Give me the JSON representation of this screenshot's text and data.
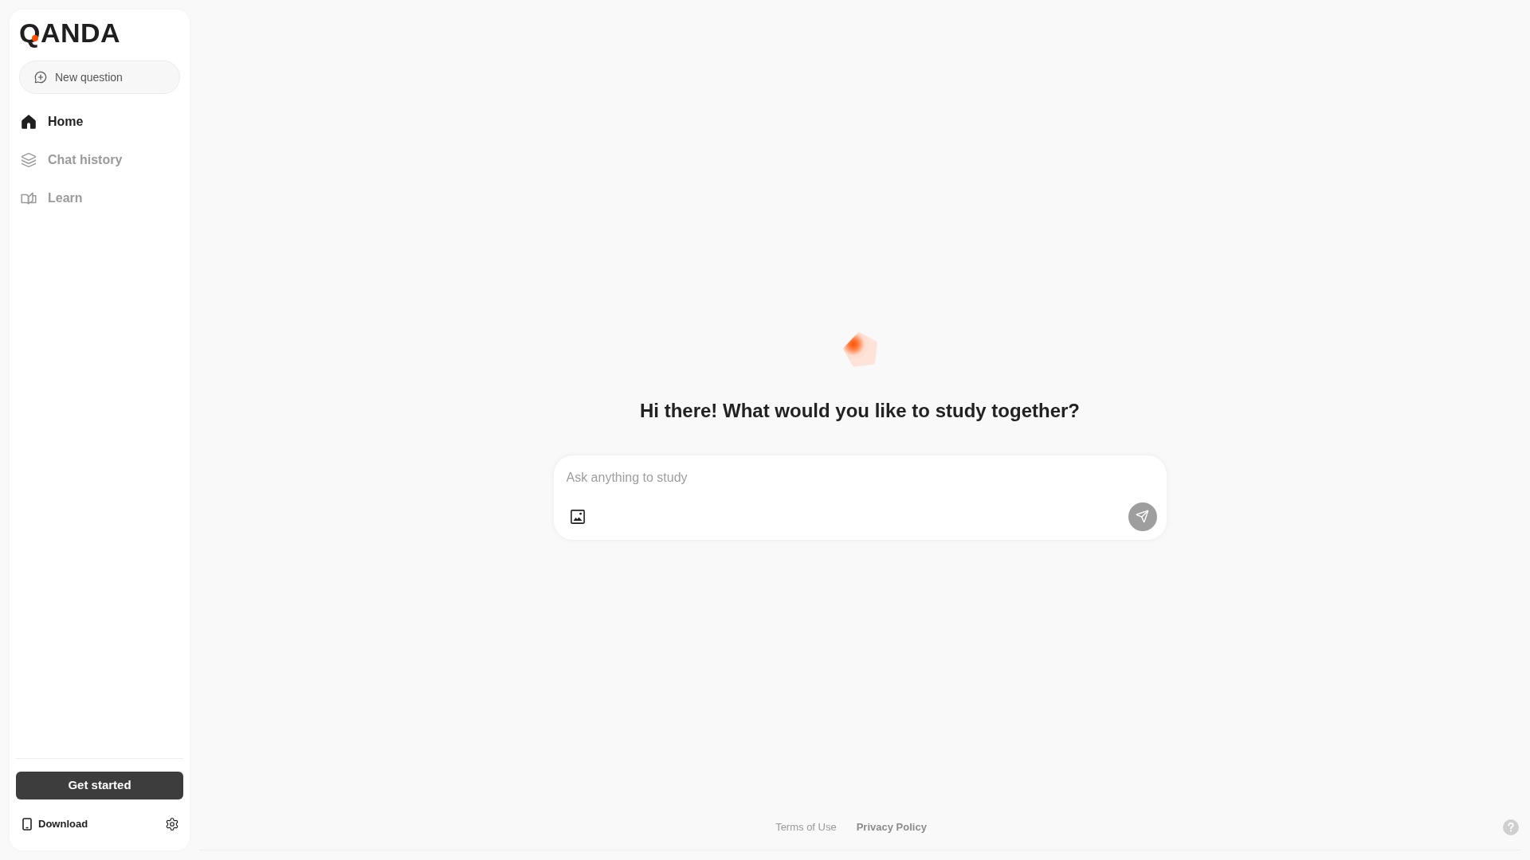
{
  "sidebar": {
    "logo": "QANDA",
    "new_question_button": "New question",
    "nav_items": [
      {
        "label": "Home",
        "selected": true
      },
      {
        "label": "Chat history",
        "selected": false
      },
      {
        "label": "Learn",
        "selected": false
      }
    ],
    "get_started_button": "Get started",
    "download_link": "Download"
  },
  "main": {
    "greeting": "Hi there! What would you like to study together?",
    "question_input": {
      "placeholder": "Ask anything to study"
    },
    "send_button": {
      "disabled": true
    }
  },
  "footer": {
    "links": [
      {
        "label": "Terms of Use",
        "kind": "plain"
      },
      {
        "label": "Privacy Policy",
        "kind": "strong"
      }
    ]
  }
}
